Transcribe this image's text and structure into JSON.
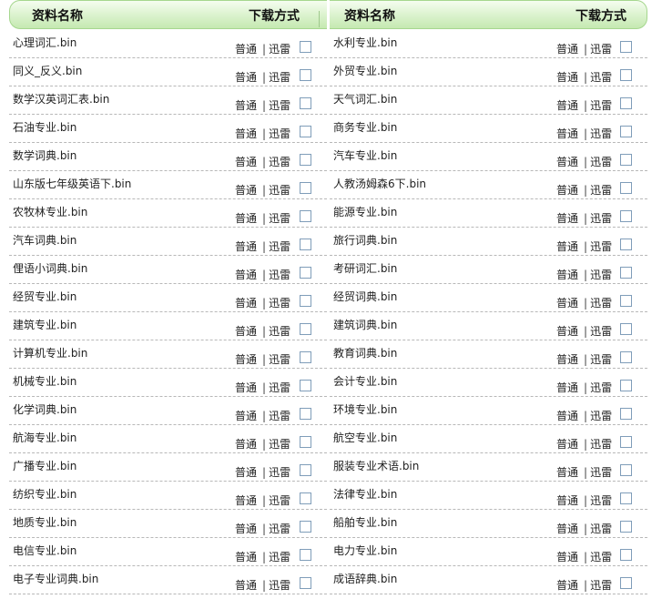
{
  "header": {
    "col_name": "资料名称",
    "col_download": "下载方式"
  },
  "download_links": {
    "normal": "普通",
    "separator": "|",
    "thunder": "迅雷"
  },
  "left": [
    "心理词汇.bin",
    "同义_反义.bin",
    "数学汉英词汇表.bin",
    "石油专业.bin",
    "数学词典.bin",
    "山东版七年级英语下.bin",
    "农牧林专业.bin",
    "汽车词典.bin",
    "俚语小词典.bin",
    "经贸专业.bin",
    "建筑专业.bin",
    "计算机专业.bin",
    "机械专业.bin",
    "化学词典.bin",
    "航海专业.bin",
    "广播专业.bin",
    "纺织专业.bin",
    "地质专业.bin",
    "电信专业.bin",
    "电子专业词典.bin"
  ],
  "right": [
    "水利专业.bin",
    "外贸专业.bin",
    "天气词汇.bin",
    "商务专业.bin",
    "汽车专业.bin",
    "人教汤姆森6下.bin",
    "能源专业.bin",
    "旅行词典.bin",
    "考研词汇.bin",
    "经贸词典.bin",
    "建筑词典.bin",
    "教育词典.bin",
    "会计专业.bin",
    "环境专业.bin",
    "航空专业.bin",
    "服装专业术语.bin",
    "法律专业.bin",
    "船舶专业.bin",
    "电力专业.bin",
    "成语辞典.bin"
  ]
}
